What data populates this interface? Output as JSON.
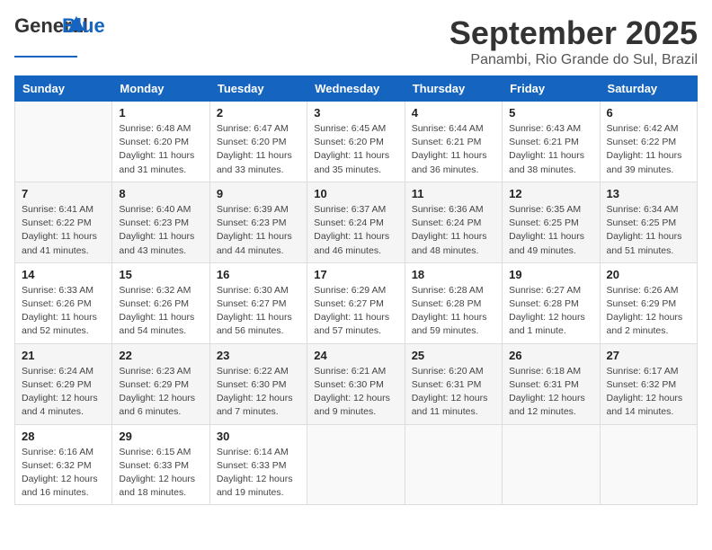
{
  "header": {
    "logo_general": "General",
    "logo_blue": "Blue",
    "month_title": "September 2025",
    "subtitle": "Panambi, Rio Grande do Sul, Brazil"
  },
  "days_of_week": [
    "Sunday",
    "Monday",
    "Tuesday",
    "Wednesday",
    "Thursday",
    "Friday",
    "Saturday"
  ],
  "weeks": [
    [
      {
        "day": "",
        "info": ""
      },
      {
        "day": "1",
        "info": "Sunrise: 6:48 AM\nSunset: 6:20 PM\nDaylight: 11 hours\nand 31 minutes."
      },
      {
        "day": "2",
        "info": "Sunrise: 6:47 AM\nSunset: 6:20 PM\nDaylight: 11 hours\nand 33 minutes."
      },
      {
        "day": "3",
        "info": "Sunrise: 6:45 AM\nSunset: 6:20 PM\nDaylight: 11 hours\nand 35 minutes."
      },
      {
        "day": "4",
        "info": "Sunrise: 6:44 AM\nSunset: 6:21 PM\nDaylight: 11 hours\nand 36 minutes."
      },
      {
        "day": "5",
        "info": "Sunrise: 6:43 AM\nSunset: 6:21 PM\nDaylight: 11 hours\nand 38 minutes."
      },
      {
        "day": "6",
        "info": "Sunrise: 6:42 AM\nSunset: 6:22 PM\nDaylight: 11 hours\nand 39 minutes."
      }
    ],
    [
      {
        "day": "7",
        "info": "Sunrise: 6:41 AM\nSunset: 6:22 PM\nDaylight: 11 hours\nand 41 minutes."
      },
      {
        "day": "8",
        "info": "Sunrise: 6:40 AM\nSunset: 6:23 PM\nDaylight: 11 hours\nand 43 minutes."
      },
      {
        "day": "9",
        "info": "Sunrise: 6:39 AM\nSunset: 6:23 PM\nDaylight: 11 hours\nand 44 minutes."
      },
      {
        "day": "10",
        "info": "Sunrise: 6:37 AM\nSunset: 6:24 PM\nDaylight: 11 hours\nand 46 minutes."
      },
      {
        "day": "11",
        "info": "Sunrise: 6:36 AM\nSunset: 6:24 PM\nDaylight: 11 hours\nand 48 minutes."
      },
      {
        "day": "12",
        "info": "Sunrise: 6:35 AM\nSunset: 6:25 PM\nDaylight: 11 hours\nand 49 minutes."
      },
      {
        "day": "13",
        "info": "Sunrise: 6:34 AM\nSunset: 6:25 PM\nDaylight: 11 hours\nand 51 minutes."
      }
    ],
    [
      {
        "day": "14",
        "info": "Sunrise: 6:33 AM\nSunset: 6:26 PM\nDaylight: 11 hours\nand 52 minutes."
      },
      {
        "day": "15",
        "info": "Sunrise: 6:32 AM\nSunset: 6:26 PM\nDaylight: 11 hours\nand 54 minutes."
      },
      {
        "day": "16",
        "info": "Sunrise: 6:30 AM\nSunset: 6:27 PM\nDaylight: 11 hours\nand 56 minutes."
      },
      {
        "day": "17",
        "info": "Sunrise: 6:29 AM\nSunset: 6:27 PM\nDaylight: 11 hours\nand 57 minutes."
      },
      {
        "day": "18",
        "info": "Sunrise: 6:28 AM\nSunset: 6:28 PM\nDaylight: 11 hours\nand 59 minutes."
      },
      {
        "day": "19",
        "info": "Sunrise: 6:27 AM\nSunset: 6:28 PM\nDaylight: 12 hours\nand 1 minute."
      },
      {
        "day": "20",
        "info": "Sunrise: 6:26 AM\nSunset: 6:29 PM\nDaylight: 12 hours\nand 2 minutes."
      }
    ],
    [
      {
        "day": "21",
        "info": "Sunrise: 6:24 AM\nSunset: 6:29 PM\nDaylight: 12 hours\nand 4 minutes."
      },
      {
        "day": "22",
        "info": "Sunrise: 6:23 AM\nSunset: 6:29 PM\nDaylight: 12 hours\nand 6 minutes."
      },
      {
        "day": "23",
        "info": "Sunrise: 6:22 AM\nSunset: 6:30 PM\nDaylight: 12 hours\nand 7 minutes."
      },
      {
        "day": "24",
        "info": "Sunrise: 6:21 AM\nSunset: 6:30 PM\nDaylight: 12 hours\nand 9 minutes."
      },
      {
        "day": "25",
        "info": "Sunrise: 6:20 AM\nSunset: 6:31 PM\nDaylight: 12 hours\nand 11 minutes."
      },
      {
        "day": "26",
        "info": "Sunrise: 6:18 AM\nSunset: 6:31 PM\nDaylight: 12 hours\nand 12 minutes."
      },
      {
        "day": "27",
        "info": "Sunrise: 6:17 AM\nSunset: 6:32 PM\nDaylight: 12 hours\nand 14 minutes."
      }
    ],
    [
      {
        "day": "28",
        "info": "Sunrise: 6:16 AM\nSunset: 6:32 PM\nDaylight: 12 hours\nand 16 minutes."
      },
      {
        "day": "29",
        "info": "Sunrise: 6:15 AM\nSunset: 6:33 PM\nDaylight: 12 hours\nand 18 minutes."
      },
      {
        "day": "30",
        "info": "Sunrise: 6:14 AM\nSunset: 6:33 PM\nDaylight: 12 hours\nand 19 minutes."
      },
      {
        "day": "",
        "info": ""
      },
      {
        "day": "",
        "info": ""
      },
      {
        "day": "",
        "info": ""
      },
      {
        "day": "",
        "info": ""
      }
    ]
  ]
}
